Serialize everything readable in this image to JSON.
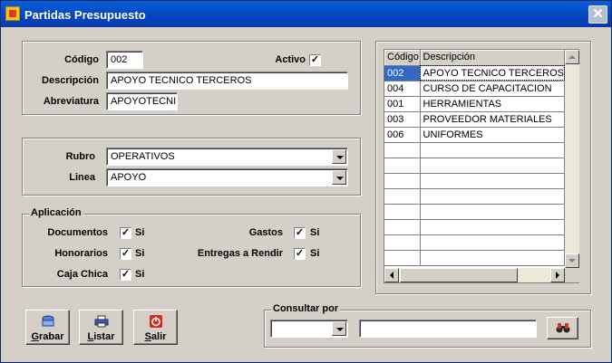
{
  "window": {
    "title": "Partidas Presupuesto",
    "close_symbol": "✕"
  },
  "general": {
    "codigo_label": "Código",
    "codigo_value": "002",
    "activo_label": "Activo",
    "activo_checked": "✓",
    "descripcion_label": "Descripción",
    "descripcion_value": "APOYO TECNICO TERCEROS",
    "abreviatura_label": "Abreviatura",
    "abreviatura_value": "APOYOTECNI"
  },
  "clasificacion": {
    "rubro_label": "Rubro",
    "rubro_value": "OPERATIVOS",
    "linea_label": "Linea",
    "linea_value": "APOYO"
  },
  "aplicacion": {
    "legend": "Aplicación",
    "documentos_label": "Documentos",
    "documentos_check": "✓",
    "documentos_si": "Si",
    "honorarios_label": "Honorarios",
    "honorarios_check": "✓",
    "honorarios_si": "Si",
    "caja_label": "Caja Chica",
    "caja_check": "✓",
    "caja_si": "Si",
    "gastos_label": "Gastos",
    "gastos_check": "✓",
    "gastos_si": "Si",
    "entregas_label": "Entregas a Rendir",
    "entregas_check": "✓",
    "entregas_si": "Si"
  },
  "grid": {
    "columns": [
      "Código",
      "Descripción"
    ],
    "rows": [
      {
        "codigo": "002",
        "descripcion": "APOYO TECNICO TERCEROS"
      },
      {
        "codigo": "004",
        "descripcion": "CURSO DE CAPACITACION"
      },
      {
        "codigo": "001",
        "descripcion": "HERRAMIENTAS"
      },
      {
        "codigo": "003",
        "descripcion": "PROVEEDOR MATERIALES"
      },
      {
        "codigo": "006",
        "descripcion": "UNIFORMES"
      }
    ]
  },
  "buttons": {
    "grabar": "Grabar",
    "listar": "Listar",
    "salir": "Salir"
  },
  "consultar": {
    "legend": "Consultar por",
    "field_value": "",
    "search_value": ""
  },
  "colors": {
    "title_bar": "#0546c2",
    "selection": "#316ac5",
    "background": "#d4d0c8"
  }
}
